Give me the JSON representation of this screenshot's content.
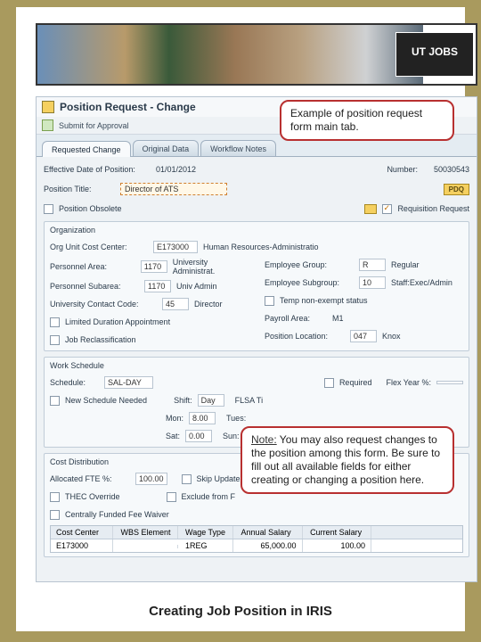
{
  "banner": {
    "logo": "UT JOBS"
  },
  "window": {
    "title": "Position Request - Change",
    "submit": "Submit for Approval"
  },
  "tabs": [
    "Requested Change",
    "Original Data",
    "Workflow Notes"
  ],
  "form": {
    "eff_date_lbl": "Effective Date of Position:",
    "eff_date_val": "01/01/2012",
    "number_lbl": "Number:",
    "number_val": "50030543",
    "pos_title_lbl": "Position Title:",
    "pos_title_val": "Director of ATS",
    "pdg_btn": "PDQ",
    "pos_obsolete": "Position Obsolete",
    "req_request": "Requisition Request"
  },
  "org": {
    "title": "Organization",
    "cc_lbl": "Org Unit Cost Center:",
    "cc_val": "E173000",
    "cc_desc": "Human Resources-Administratio",
    "pa_lbl": "Personnel Area:",
    "pa_val": "1170",
    "pa_desc": "University Administrat.",
    "eg_lbl": "Employee Group:",
    "eg_val": "R",
    "eg_desc": "Regular",
    "psa_lbl": "Personnel Subarea:",
    "psa_val": "1170",
    "psa_desc": "Univ Admin",
    "esg_lbl": "Employee Subgroup:",
    "esg_val": "10",
    "esg_desc": "Staff:Exec/Admin",
    "ucc_lbl": "University Contact Code:",
    "ucc_val": "45",
    "ucc_desc": "Director",
    "tne_lbl": "Temp non-exempt status",
    "lda_lbl": "Limited Duration Appointment",
    "payroll_lbl": "Payroll Area:",
    "payroll_val": "M1",
    "jr_lbl": "Job Reclassification",
    "ploc_lbl": "Position Location:",
    "ploc_val": "047",
    "ploc_desc": "Knox"
  },
  "sched": {
    "title": "Work Schedule",
    "schedule_lbl": "Schedule:",
    "schedule_val": "SAL-DAY",
    "req_lbl": "Required",
    "flex_lbl": "Flex Year %:",
    "nsn_lbl": "New Schedule Needed",
    "shift_lbl": "Shift:",
    "shift_val": "Day",
    "flsa_lbl": "FLSA Ti",
    "mon_lbl": "Mon:",
    "mon_val": "8.00",
    "tue_lbl": "Tues:",
    "sat_lbl": "Sat:",
    "sat_val": "0.00",
    "sun_lbl": "Sun:"
  },
  "cost": {
    "title": "Cost Distribution",
    "fte_lbl": "Allocated FTE %:",
    "fte_val": "100.00",
    "skip_lbl": "Skip Update fro",
    "thec_lbl": "THEC Override",
    "excl_lbl": "Exclude from F",
    "cffw_lbl": "Centrally Funded Fee Waiver",
    "table": {
      "headers": [
        "Cost Center",
        "WBS Element",
        "Wage Type",
        "Annual Salary",
        "Current Salary"
      ],
      "row": [
        "E173000",
        "",
        "1REG",
        "65,000.00",
        "100.00"
      ]
    }
  },
  "callouts": {
    "main": "Example of position request form main tab.",
    "note_label": "Note:",
    "note_text": " You may also request changes to the position among this form. Be sure to fill out all available fields for either creating or changing a position here."
  },
  "caption": "Creating Job Position in IRIS"
}
